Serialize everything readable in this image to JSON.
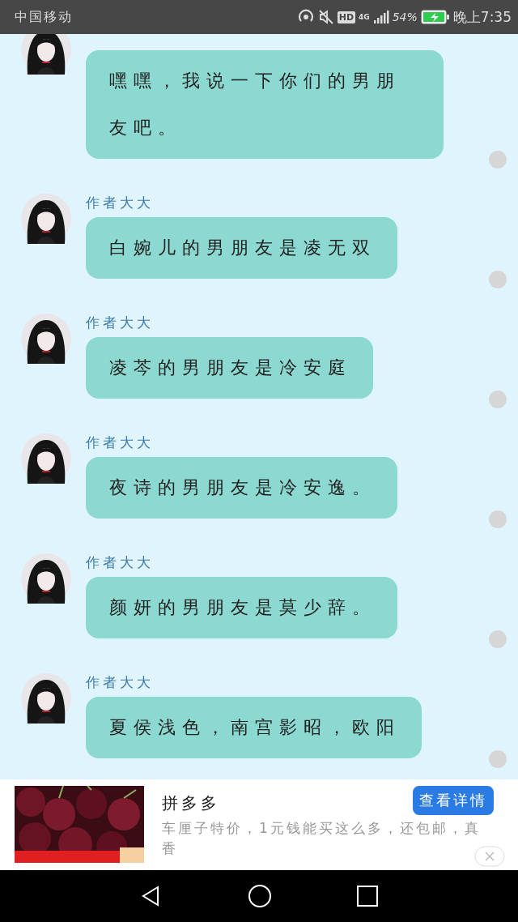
{
  "status_bar": {
    "carrier": "中国移动",
    "network_badge": "HD",
    "network_type": "4G",
    "battery": "54%",
    "time": "晚上7:35"
  },
  "messages": [
    {
      "text": "嘿嘿，我说一下你们的男朋友吧。"
    },
    {
      "author": "作者大大",
      "text": "白婉儿的男朋友是凌无双"
    },
    {
      "author": "作者大大",
      "text": "凌芩的男朋友是冷安庭"
    },
    {
      "author": "作者大大",
      "text": "夜诗的男朋友是冷安逸。"
    },
    {
      "author": "作者大大",
      "text": "颜妍的男朋友是莫少辞。"
    },
    {
      "author": "作者大大",
      "text": "夏侯浅色，南宫影昭，欧阳"
    }
  ],
  "ad": {
    "kind": "picture",
    "title": "拼多多",
    "button": "查看详情",
    "description": "车厘子特价，1元钱能买这么多，还包邮，真香"
  }
}
